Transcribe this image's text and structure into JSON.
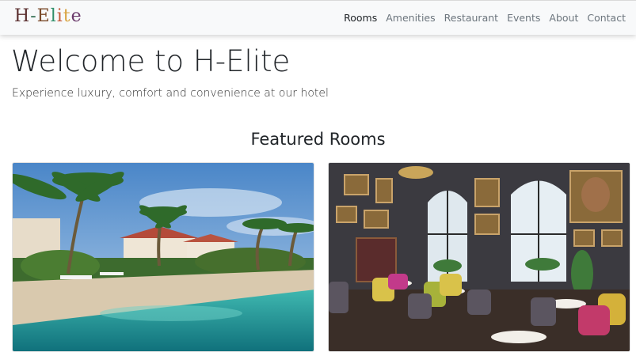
{
  "nav": {
    "brand_letters": [
      "H",
      "-",
      "E",
      "l",
      "i",
      "t",
      "e"
    ],
    "brand_colors": [
      "#5a2e2e",
      "#2e6b4f",
      "#7a4a2a",
      "#2f8f6a",
      "#c45a3a",
      "#d9a441",
      "#6b3a6b"
    ],
    "links": [
      "Rooms",
      "Amenities",
      "Restaurant",
      "Events",
      "About",
      "Contact"
    ],
    "active": "Rooms"
  },
  "hero": {
    "title": "Welcome to H-Elite",
    "subtitle": "Experience luxury, comfort and convenience at our hotel"
  },
  "featured": {
    "title": "Featured Rooms",
    "rooms": [
      {
        "image": "tropical-resort-pool-photo"
      },
      {
        "image": "vintage-restaurant-interior-photo"
      }
    ]
  }
}
